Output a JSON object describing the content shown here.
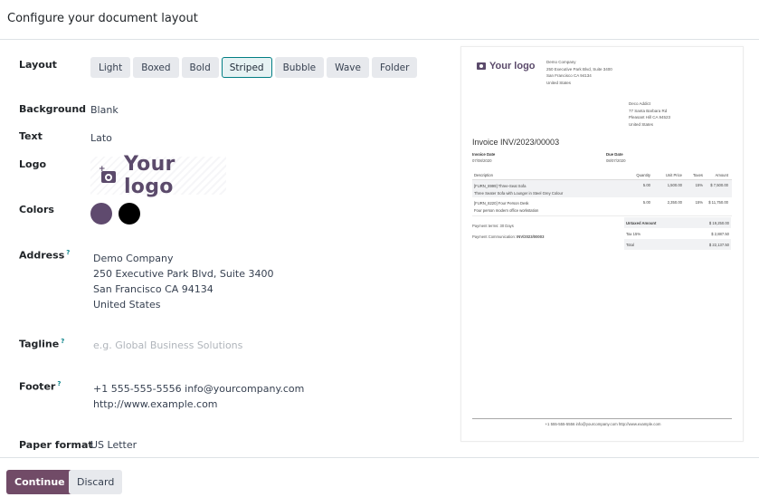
{
  "header": {
    "title": "Configure your document layout"
  },
  "form": {
    "layout": {
      "label": "Layout",
      "options": [
        "Light",
        "Boxed",
        "Bold",
        "Striped",
        "Bubble",
        "Wave",
        "Folder"
      ],
      "selected": "Striped"
    },
    "background": {
      "label": "Background",
      "value": "Blank"
    },
    "text": {
      "label": "Text",
      "value": "Lato"
    },
    "logo": {
      "label": "Logo",
      "text": "Your logo",
      "icon": "camera-add-icon"
    },
    "colors": {
      "label": "Colors",
      "primary": "#5f4a6e",
      "secondary": "#000000"
    },
    "address": {
      "label": "Address",
      "help": "?",
      "lines": [
        "Demo Company",
        "250 Executive Park Blvd, Suite 3400",
        "San Francisco CA 94134",
        "United States"
      ]
    },
    "tagline": {
      "label": "Tagline",
      "help": "?",
      "value": "",
      "placeholder": "e.g. Global Business Solutions"
    },
    "footer": {
      "label": "Footer",
      "help": "?",
      "lines": [
        "+1 555-555-5556 info@yourcompany.com",
        "http://www.example.com"
      ]
    },
    "paper_format": {
      "label": "Paper format",
      "value": "US Letter"
    }
  },
  "actions": {
    "continue": "Continue",
    "discard": "Discard"
  },
  "preview": {
    "logo_text": "Your logo",
    "company_lines": [
      "Demo Company",
      "250 Executive Park Blvd, Suite 3400",
      "San Francisco CA 94134",
      "United States"
    ],
    "customer_lines": [
      "Deco Addict",
      "77 Santa Barbara Rd",
      "Pleasant Hill CA 94523",
      "United States"
    ],
    "title": "Invoice INV/2023/00003",
    "invoice_date_label": "Invoice Date",
    "invoice_date": "07/08/2020",
    "due_date_label": "Due Date",
    "due_date": "08/07/2020",
    "columns": {
      "description": "Description",
      "quantity": "Quantity",
      "unit_price": "Unit Price",
      "taxes": "Taxes",
      "amount": "Amount"
    },
    "lines": [
      {
        "name": "[FURN_8999] Three-Seat Sofa",
        "desc": "Three Seater Sofa with Lounger in Steel Grey Colour",
        "qty": "5.00",
        "price": "1,500.00",
        "tax": "15%",
        "amount": "$ 7,500.00"
      },
      {
        "name": "[FURN_8220] Four Person Desk",
        "desc": "Four person modern office workstation",
        "qty": "5.00",
        "price": "2,350.00",
        "tax": "15%",
        "amount": "$ 11,750.00"
      }
    ],
    "payment_terms": "Payment terms: 30 Days",
    "payment_comm_label": "Payment Communication:",
    "payment_comm_value": "INV/2023/00003",
    "totals": [
      {
        "label": "Untaxed Amount",
        "value": "$ 19,250.00"
      },
      {
        "label": "Tax 15%",
        "value": "$ 2,887.50"
      },
      {
        "label": "Total",
        "value": "$ 22,137.50"
      }
    ],
    "footer": "+1 555-555-5556 info@yourcompany.com http://www.example.com"
  }
}
